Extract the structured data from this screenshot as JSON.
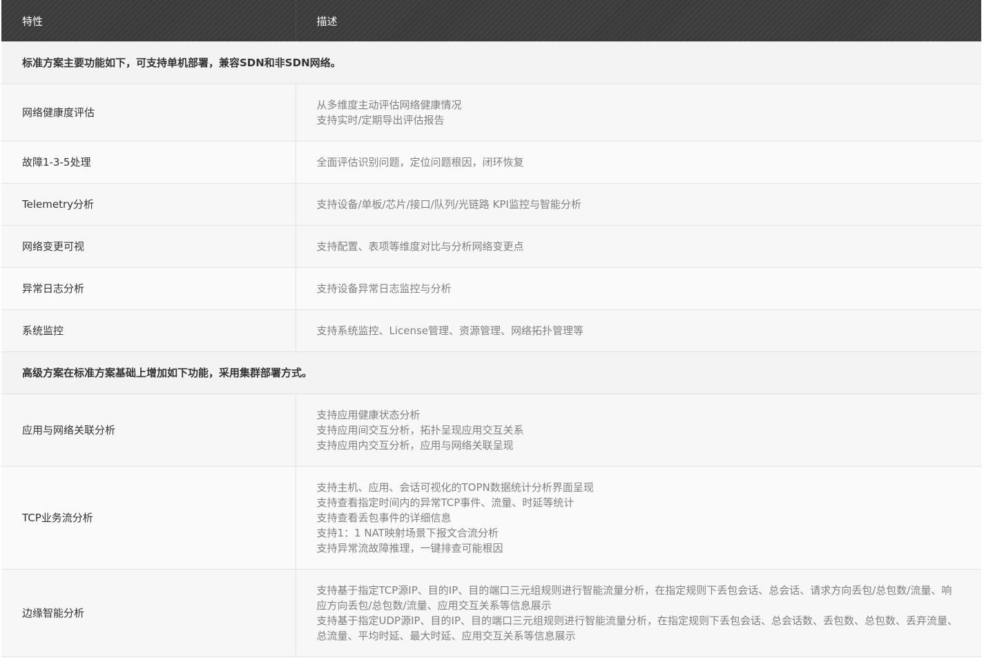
{
  "header": {
    "feature": "特性",
    "description": "描述"
  },
  "sections": [
    {
      "title": "标准方案主要功能如下，可支持单机部署，兼容SDN和非SDN网络。",
      "rows": [
        {
          "feature": "网络健康度评估",
          "desc": [
            "从多维度主动评估网络健康情况",
            "支持实时/定期导出评估报告"
          ]
        },
        {
          "feature": "故障1-3-5处理",
          "desc": [
            "全面评估识别问题，定位问题根因，闭环恢复"
          ]
        },
        {
          "feature": "Telemetry分析",
          "desc": [
            "支持设备/单板/芯片/接口/队列/光链路 KPI监控与智能分析"
          ]
        },
        {
          "feature": "网络变更可视",
          "desc": [
            "支持配置、表项等维度对比与分析网络变更点"
          ]
        },
        {
          "feature": "异常日志分析",
          "desc": [
            "支持设备异常日志监控与分析"
          ]
        },
        {
          "feature": "系统监控",
          "desc": [
            "支持系统监控、License管理、资源管理、网络拓扑管理等"
          ]
        }
      ]
    },
    {
      "title": "高级方案在标准方案基础上增加如下功能，采用集群部署方式。",
      "rows": [
        {
          "feature": "应用与网络关联分析",
          "desc": [
            "支持应用健康状态分析",
            "支持应用间交互分析，拓扑呈现应用交互关系",
            "支持应用内交互分析，应用与网络关联呈现"
          ]
        },
        {
          "feature": "TCP业务流分析",
          "desc": [
            "支持主机、应用、会话可视化的TOPN数据统计分析界面呈现",
            "支持查看指定时间内的异常TCP事件、流量、时延等统计",
            "支持查看丢包事件的详细信息",
            "支持1：1 NAT映射场景下报文合流分析",
            "支持异常流故障推理，一键排查可能根因"
          ]
        },
        {
          "feature": "边缘智能分析",
          "desc": [
            "支持基于指定TCP源IP、目的IP、目的端口三元组规则进行智能流量分析，在指定规则下丢包会话、总会话、请求方向丢包/总包数/流量、响应方向丢包/总包数/流量、应用交互关系等信息展示",
            "支持基于指定UDP源IP、目的IP、目的端口三元组规则进行智能流量分析，在指定规则下丢包会话、总会话数、丢包数、总包数、丢弃流量、总流量、平均时延、最大时延、应用交互关系等信息展示"
          ]
        }
      ]
    }
  ]
}
